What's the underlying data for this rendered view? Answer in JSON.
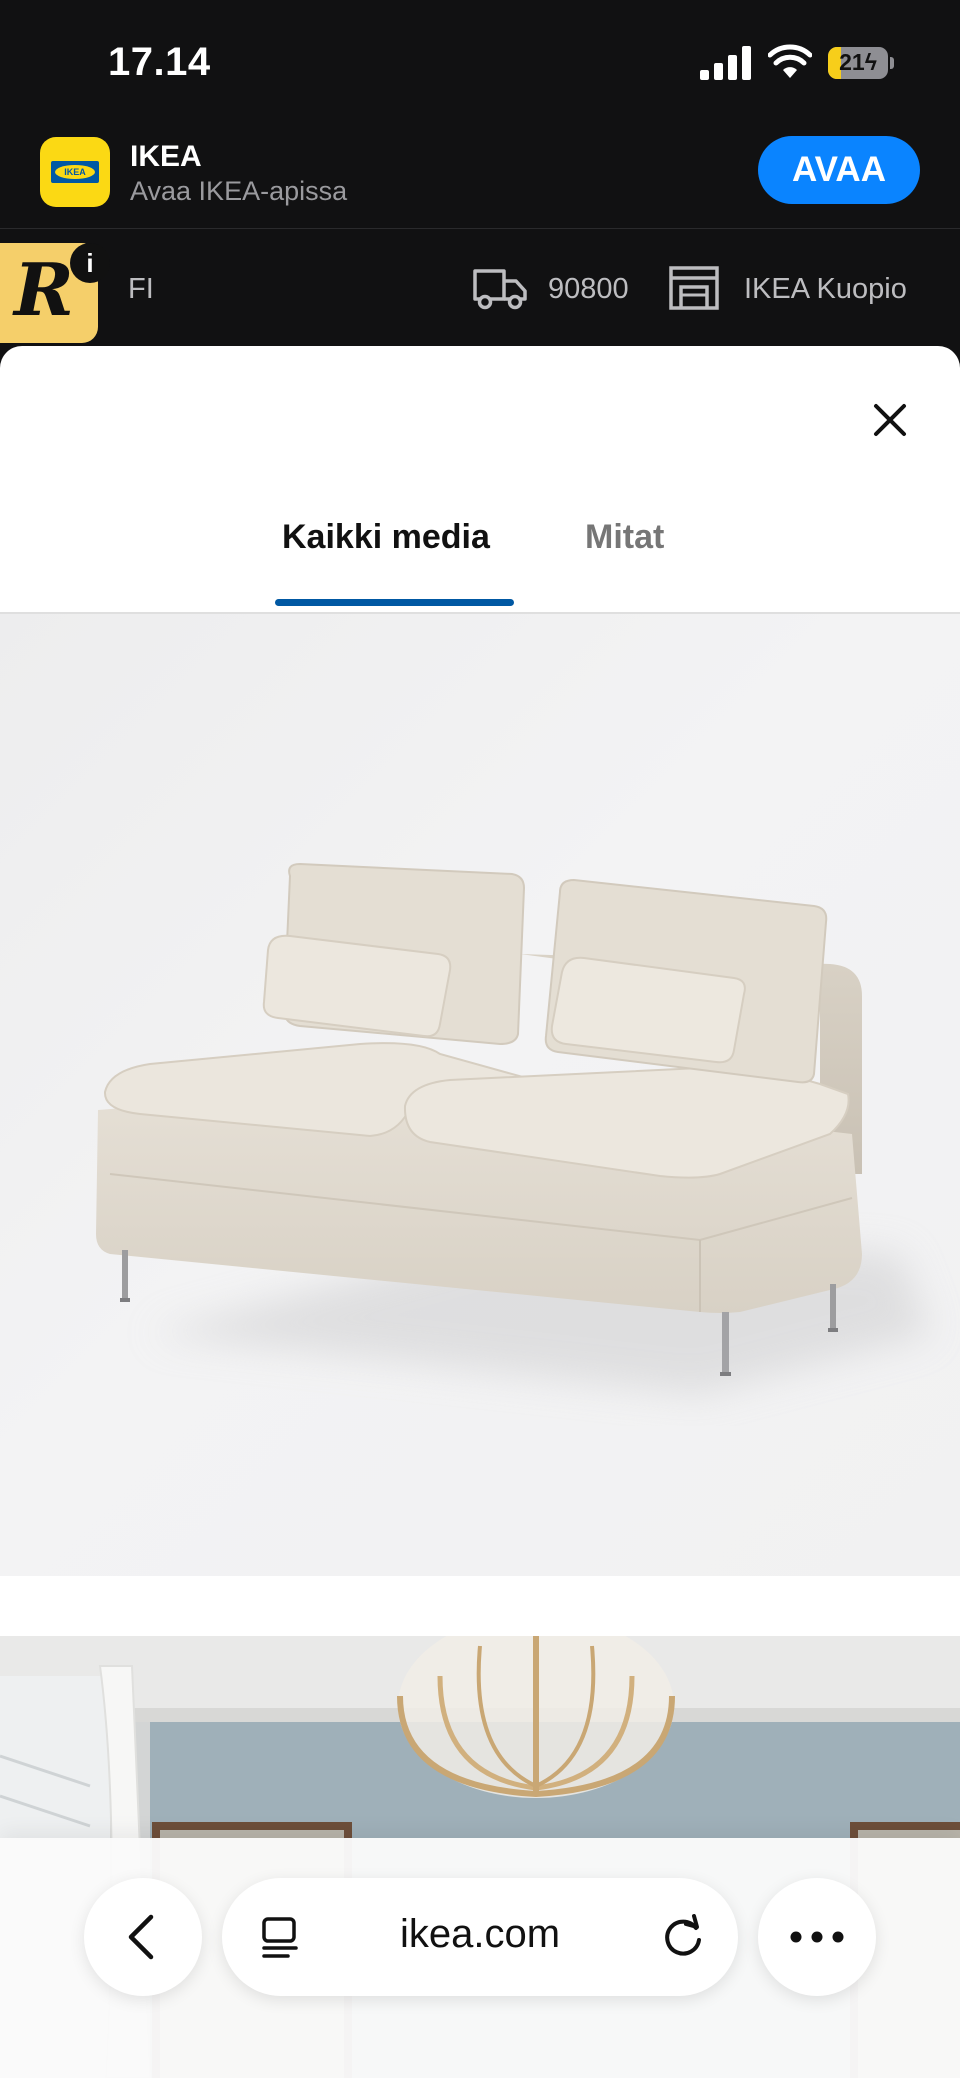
{
  "status_bar": {
    "time": "17.14",
    "battery_level": "21",
    "battery_fraction": 0.21,
    "battery_state": "charging"
  },
  "app_banner": {
    "icon": "ikea-app-icon",
    "app_name": "IKEA",
    "subtitle": "Avaa IKEA-apissa",
    "open_label": "AVAA",
    "accent_color": "#0a84ff"
  },
  "location_strip": {
    "badge_letter": "R",
    "badge_info": "i",
    "language": "FI",
    "postal_code": "90800",
    "store": "IKEA Kuopio"
  },
  "modal": {
    "close_icon": "close-icon",
    "tabs": [
      {
        "label": "Kaikki media",
        "active": true
      },
      {
        "label": "Mitat",
        "active": false
      }
    ],
    "active_tab_color": "#0058a3"
  },
  "browser": {
    "url": "ikea.com",
    "icons": [
      "chevron-left-icon",
      "reader-icon",
      "reload-icon",
      "more-icon"
    ]
  }
}
